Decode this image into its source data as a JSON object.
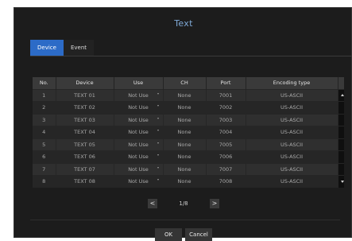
{
  "title": "Text",
  "tabs": [
    {
      "label": "Device",
      "active": true
    },
    {
      "label": "Event",
      "active": false
    }
  ],
  "table": {
    "headers": [
      "No.",
      "Device",
      "Use",
      "CH",
      "Port",
      "Encoding type"
    ],
    "rows": [
      {
        "no": "1",
        "device": "TEXT 01",
        "use": "Not Use",
        "ch": "None",
        "port": "7001",
        "encoding": "US-ASCII"
      },
      {
        "no": "2",
        "device": "TEXT 02",
        "use": "Not Use",
        "ch": "None",
        "port": "7002",
        "encoding": "US-ASCII"
      },
      {
        "no": "3",
        "device": "TEXT 03",
        "use": "Not Use",
        "ch": "None",
        "port": "7003",
        "encoding": "US-ASCII"
      },
      {
        "no": "4",
        "device": "TEXT 04",
        "use": "Not Use",
        "ch": "None",
        "port": "7004",
        "encoding": "US-ASCII"
      },
      {
        "no": "5",
        "device": "TEXT 05",
        "use": "Not Use",
        "ch": "None",
        "port": "7005",
        "encoding": "US-ASCII"
      },
      {
        "no": "6",
        "device": "TEXT 06",
        "use": "Not Use",
        "ch": "None",
        "port": "7006",
        "encoding": "US-ASCII"
      },
      {
        "no": "7",
        "device": "TEXT 07",
        "use": "Not Use",
        "ch": "None",
        "port": "7007",
        "encoding": "US-ASCII"
      },
      {
        "no": "8",
        "device": "TEXT 08",
        "use": "Not Use",
        "ch": "None",
        "port": "7008",
        "encoding": "US-ASCII"
      }
    ]
  },
  "pager": {
    "prev": "<",
    "next": ">",
    "page": "1/8"
  },
  "buttons": {
    "ok": "OK",
    "cancel": "Cancel"
  },
  "colors": {
    "accent": "#2c6bc7",
    "title": "#7fa9d6",
    "background": "#1c1c1c"
  }
}
